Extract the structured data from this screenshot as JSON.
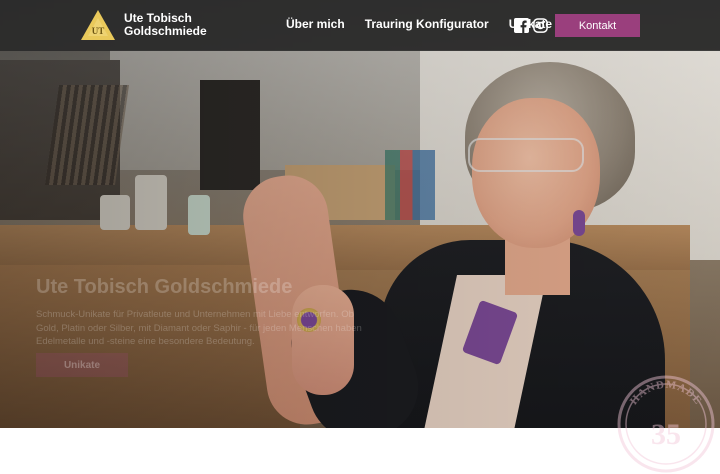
{
  "brand": {
    "name_line1": "Ute Tobisch",
    "name_line2": "Goldschmiede",
    "logo_initials": "UT",
    "logo_color": "#e9c95b"
  },
  "nav": {
    "links": [
      "Über mich",
      "Trauring Konfigurator",
      "Unikate"
    ],
    "social_icons": [
      "facebook-icon",
      "instagram-icon"
    ],
    "contact_label": "Kontakt"
  },
  "hero": {
    "title": "Ute Tobisch Goldschmiede",
    "description": "Schmuck-Unikate für Privatleute und Unternehmen mit Liebe entworfen. Ob Gold, Platin oder Silber, mit Diamant oder Saphir - für jeden Menschen haben Edelmetalle und -steine eine besondere Bedeutung.",
    "button_label": "Unikate"
  },
  "badge": {
    "top_text": "HANDMADE",
    "number": "35"
  },
  "colors": {
    "accent": "#9a3f7d",
    "navbar": "#282828",
    "logo_gold": "#e9c95b"
  }
}
